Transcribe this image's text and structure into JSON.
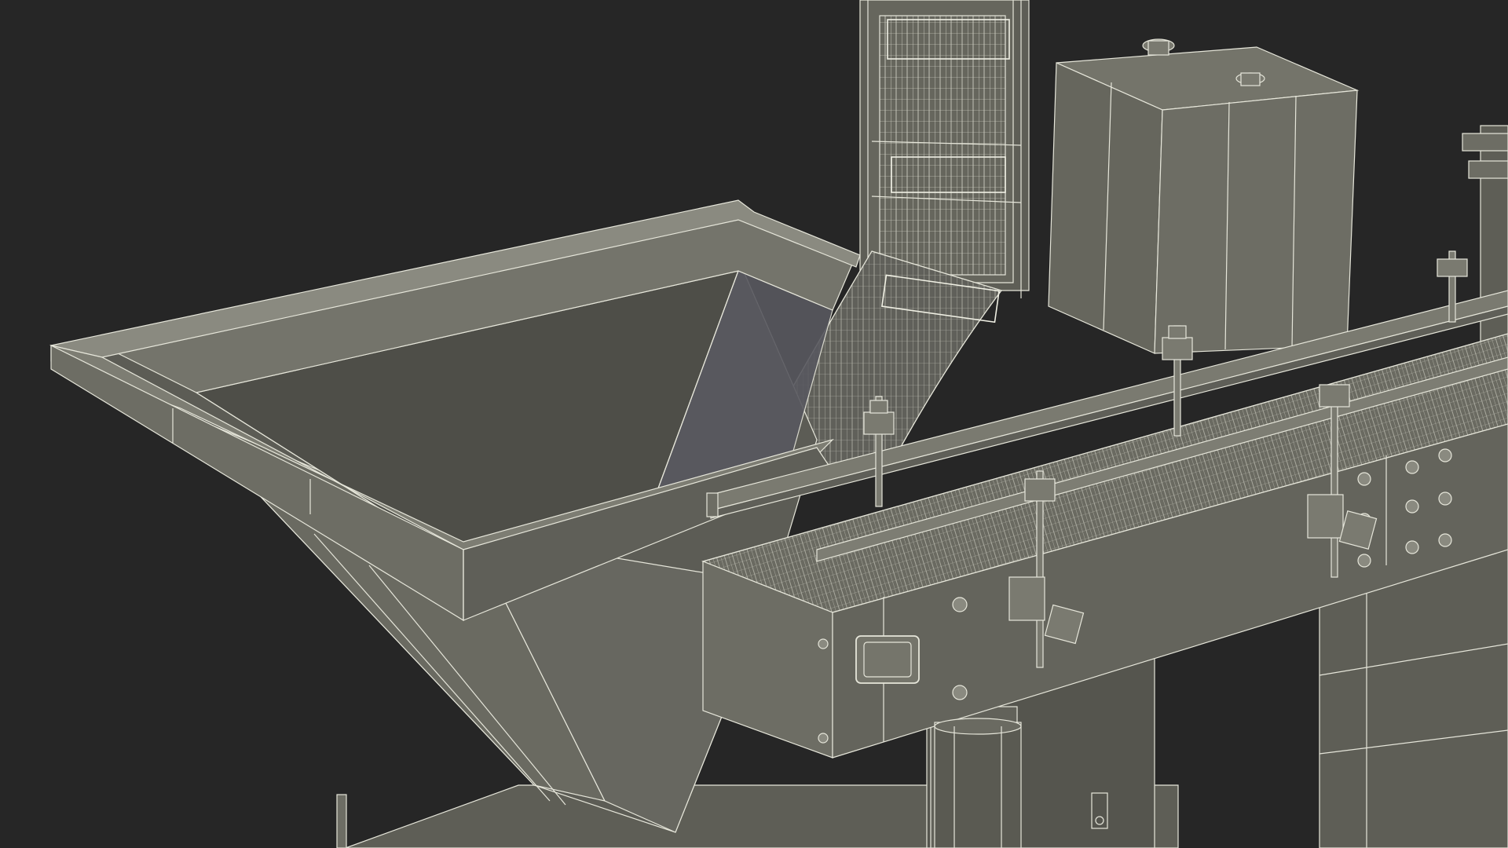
{
  "scene": {
    "subject": "wireframe-render-hopper-elevator-conveyor",
    "colors": {
      "background": "#262626",
      "surface": "#6b6b61",
      "surface_dark": "#5a5a52",
      "surface_light": "#7a7a70",
      "wire": "#e6e6da",
      "wire_dim": "#c9c9bc"
    }
  }
}
